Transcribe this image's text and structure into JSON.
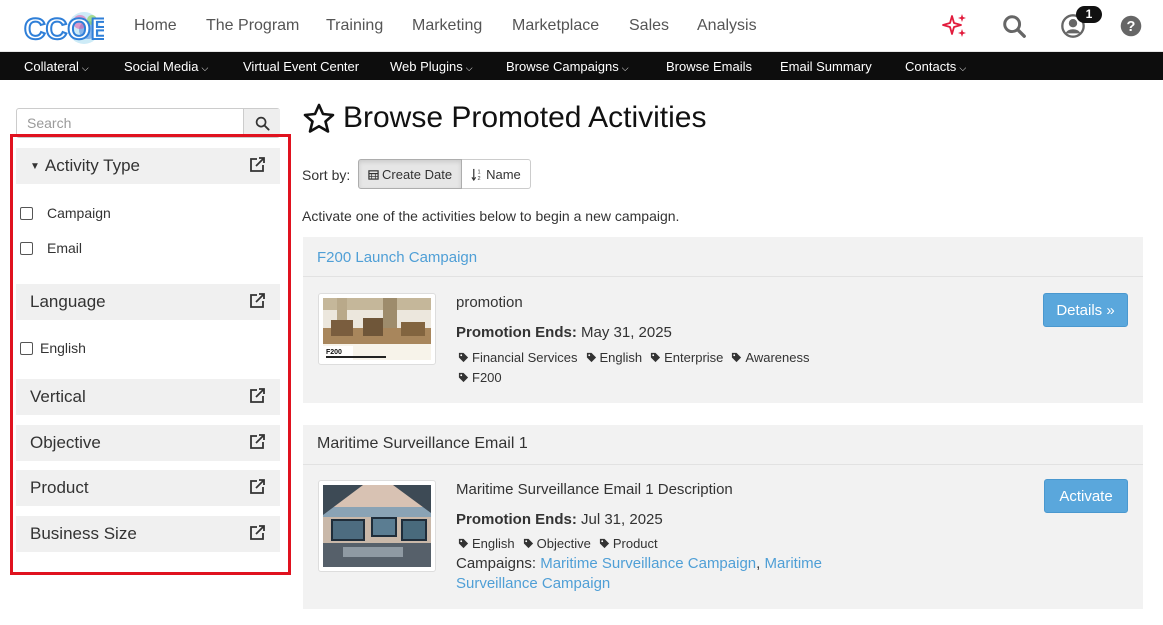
{
  "header": {
    "logo_text": "CCOE",
    "nav": [
      "Home",
      "The Program",
      "Training",
      "Marketing",
      "Marketplace",
      "Sales",
      "Analysis"
    ],
    "notification_count": "1"
  },
  "subnav": [
    {
      "label": "Collateral",
      "dropdown": true
    },
    {
      "label": "Social Media",
      "dropdown": true
    },
    {
      "label": "Virtual Event Center",
      "dropdown": false
    },
    {
      "label": "Web Plugins",
      "dropdown": true
    },
    {
      "label": "Browse Campaigns",
      "dropdown": true
    },
    {
      "label": "Browse Emails",
      "dropdown": false
    },
    {
      "label": "Email Summary",
      "dropdown": false
    },
    {
      "label": "Contacts",
      "dropdown": true
    }
  ],
  "sidebar": {
    "search_placeholder": "Search",
    "facets": {
      "activity_type": {
        "label": "Activity Type",
        "options": [
          "Campaign",
          "Email"
        ]
      },
      "language": {
        "label": "Language",
        "options": [
          "English"
        ]
      },
      "vertical": {
        "label": "Vertical"
      },
      "objective": {
        "label": "Objective"
      },
      "product": {
        "label": "Product"
      },
      "business_size": {
        "label": "Business Size"
      }
    }
  },
  "main": {
    "title": "Browse Promoted Activities",
    "sort_label": "Sort by:",
    "sort_options": [
      "Create Date",
      "Name"
    ],
    "intro": "Activate one of the activities below to begin a new campaign.",
    "cards": [
      {
        "title": "F200 Launch Campaign",
        "description": "promotion",
        "ends_label": "Promotion Ends:",
        "ends_value": "May 31, 2025",
        "tags": [
          "Financial Services",
          "English",
          "Enterprise",
          "Awareness",
          "F200"
        ],
        "button": "Details »",
        "thumb_caption": "F200"
      },
      {
        "title": "Maritime Surveillance Email 1",
        "description": "Maritime Surveillance Email 1 Description",
        "ends_label": "Promotion Ends:",
        "ends_value": "Jul 31, 2025",
        "tags": [
          "English",
          "Objective",
          "Product"
        ],
        "campaigns_label": "Campaigns:",
        "campaigns": [
          "Maritime Surveillance Campaign",
          "Maritime Surveillance Campaign"
        ],
        "button": "Activate"
      }
    ]
  },
  "colors": {
    "accent": "#5aa7dc",
    "link": "#4f9fd6",
    "highlight": "#e0121f",
    "subnav_bg": "#0d0d0d"
  },
  "icons": [
    "logo",
    "sparkle-icon",
    "search-icon",
    "user-icon",
    "help-icon",
    "external-link-icon",
    "star-icon",
    "calendar-icon",
    "sort-alpha-icon",
    "tag-icon",
    "caret-down-icon"
  ]
}
